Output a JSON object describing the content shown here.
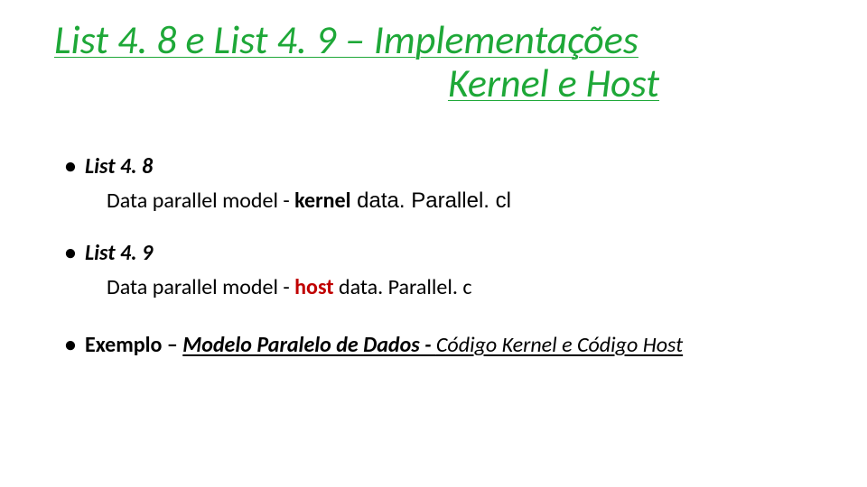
{
  "title": {
    "line1": "List 4. 8  e  List 4. 9 – Implementações",
    "line2": "Kernel e Host"
  },
  "items": {
    "item1": {
      "label": "List 4. 8",
      "sub_prefix": "Data parallel model - ",
      "kernel_word": "kernel",
      "kernel_file": "  data. Parallel. cl"
    },
    "item2": {
      "label": "List 4. 9",
      "sub_prefix": "Data parallel model - ",
      "host_word": "host",
      "host_file": " data. Parallel. c"
    },
    "example": {
      "label": "Exemplo – ",
      "link_bold": "Modelo Paralelo de Dados  -  ",
      "link_rest": "Código Kernel e Código Host"
    }
  }
}
